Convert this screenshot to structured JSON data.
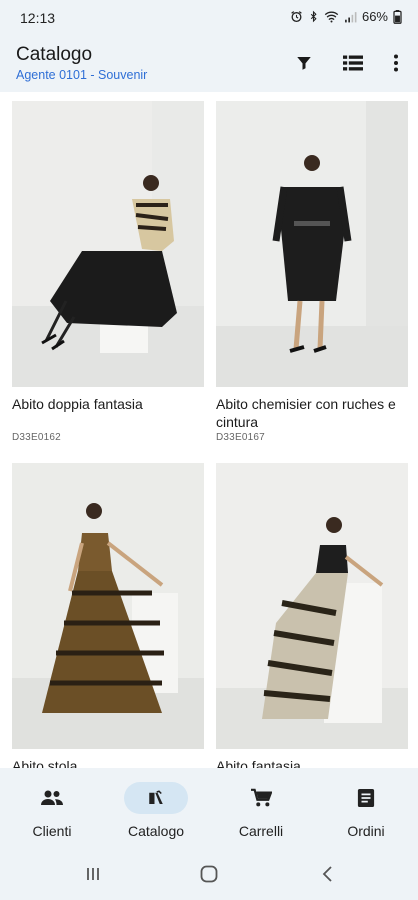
{
  "status": {
    "time": "12:13",
    "battery": "66%"
  },
  "appbar": {
    "title": "Catalogo",
    "subtitle": "Agente 0101 - Souvenir",
    "icons": [
      "filter-icon",
      "view-list-icon",
      "more-vert-icon"
    ]
  },
  "products": [
    {
      "name": "Abito doppia fantasia",
      "code": "D33E0162"
    },
    {
      "name": "Abito chemisier con ruches e cintura",
      "code": "D33E0167"
    },
    {
      "name": "Abito stola",
      "code": ""
    },
    {
      "name": "Abito fantasia",
      "code": ""
    }
  ],
  "nav": {
    "items": [
      {
        "label": "Clienti",
        "icon": "people-icon"
      },
      {
        "label": "Catalogo",
        "icon": "catalog-icon",
        "active": true
      },
      {
        "label": "Carrelli",
        "icon": "cart-icon"
      },
      {
        "label": "Ordini",
        "icon": "orders-icon"
      }
    ]
  },
  "colors": {
    "background": "#eef3f7",
    "accent": "#2f6fd6",
    "active_pill": "#d5e6f3"
  }
}
